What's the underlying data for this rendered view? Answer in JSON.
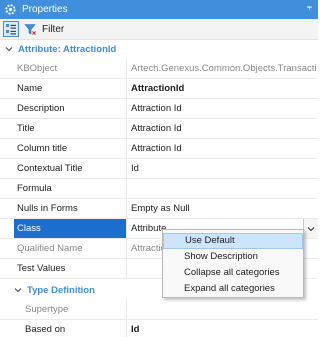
{
  "panel": {
    "title": "Properties",
    "pin_glyph": "⫧",
    "icons": [
      "gear-icon",
      "pin-icon"
    ]
  },
  "toolbar": {
    "categorized_icon": "categorized-icon",
    "filter_icon": "filter-icon",
    "filter_label": "Filter"
  },
  "attribute_section": {
    "label": "Attribute: AttractionId",
    "rows": [
      {
        "name": "KBObject",
        "value": "Artech.Genexus.Common.Objects.Transaction"
      },
      {
        "name": "Name",
        "value": "AttractionId"
      },
      {
        "name": "Description",
        "value": "Attraction Id"
      },
      {
        "name": "Title",
        "value": "Attraction Id"
      },
      {
        "name": "Column title",
        "value": "Attraction Id"
      },
      {
        "name": "Contextual Title",
        "value": "Id"
      },
      {
        "name": "Formula",
        "value": ""
      },
      {
        "name": "Nulls in Forms",
        "value": "Empty as Null"
      },
      {
        "name": "Class",
        "value": "Attribute"
      },
      {
        "name": "Qualified Name",
        "value": "Attractio"
      },
      {
        "name": "Test Values",
        "value": ""
      }
    ]
  },
  "type_section": {
    "label": "Type Definition",
    "rows": [
      {
        "name": "Supertype",
        "value": ""
      },
      {
        "name": "Based on",
        "value": "Id"
      }
    ]
  },
  "context_menu": {
    "items": [
      "Use Default",
      "Show Description",
      "Collapse all categories",
      "Expand all categories"
    ]
  },
  "colors": {
    "title_bar": "#3f8fdc",
    "section_text": "#3f8fdc",
    "selected_row": "#1c6fd1",
    "menu_hover": "#cde4fb"
  }
}
